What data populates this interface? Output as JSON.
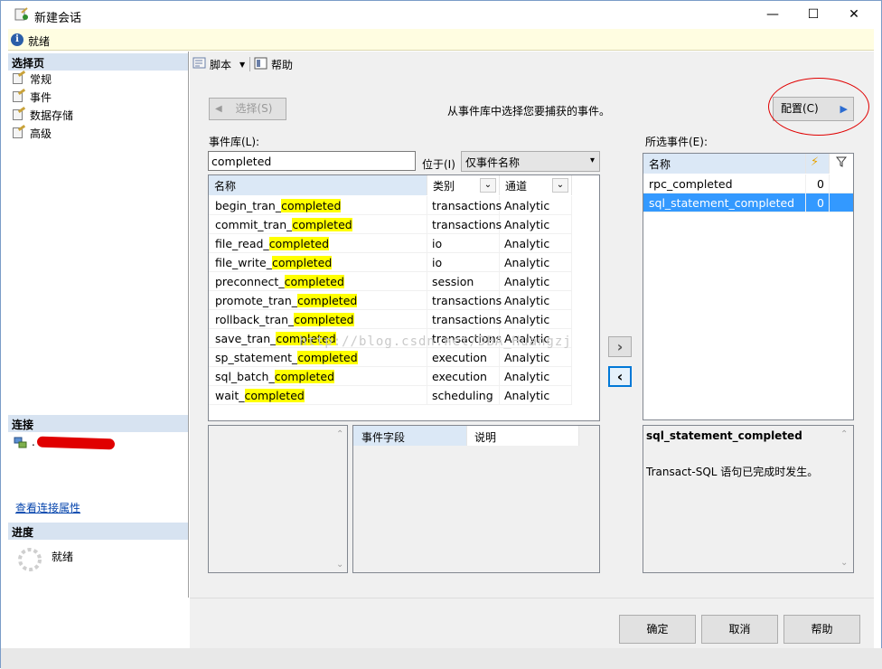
{
  "window": {
    "title": "新建会话",
    "minimize": "—",
    "maximize": "☐",
    "close": "✕"
  },
  "status": {
    "text": "就绪",
    "icon": "info-icon"
  },
  "left": {
    "pages_header": "选择页",
    "pages": [
      {
        "label": "常规",
        "icon": "page-wand-icon"
      },
      {
        "label": "事件",
        "icon": "page-wand-icon"
      },
      {
        "label": "数据存储",
        "icon": "page-wand-icon"
      },
      {
        "label": "高级",
        "icon": "page-wand-icon"
      }
    ],
    "connection_header": "连接",
    "connection_server": ".",
    "view_connection_link": "查看连接属性",
    "progress_header": "进度",
    "progress_status": "就绪"
  },
  "toolbar": {
    "script_label": "脚本",
    "help_label": "帮助"
  },
  "main": {
    "select_button": "选择(S)",
    "instruction": "从事件库中选择您要捕获的事件。",
    "configure_button": "配置(C)",
    "library_label": "事件库(L):",
    "search_value": "completed",
    "position_label": "位于(I)",
    "position_select": "仅事件名称",
    "library_columns": [
      "名称",
      "类别",
      "通道"
    ],
    "library_rows": [
      {
        "prefix": "begin_tran_",
        "match": "completed",
        "category": "transactions",
        "channel": "Analytic"
      },
      {
        "prefix": "commit_tran_",
        "match": "completed",
        "category": "transactions",
        "channel": "Analytic"
      },
      {
        "prefix": "file_read_",
        "match": "completed",
        "category": "io",
        "channel": "Analytic"
      },
      {
        "prefix": "file_write_",
        "match": "completed",
        "category": "io",
        "channel": "Analytic"
      },
      {
        "prefix": "preconnect_",
        "match": "completed",
        "category": "session",
        "channel": "Analytic"
      },
      {
        "prefix": "promote_tran_",
        "match": "completed",
        "category": "transactions",
        "channel": "Analytic"
      },
      {
        "prefix": "rollback_tran_",
        "match": "completed",
        "category": "transactions",
        "channel": "Analytic"
      },
      {
        "prefix": "save_tran_",
        "match": "completed",
        "category": "transactions",
        "channel": "Analytic"
      },
      {
        "prefix": "sp_statement_",
        "match": "completed",
        "category": "execution",
        "channel": "Analytic"
      },
      {
        "prefix": "sql_batch_",
        "match": "completed",
        "category": "execution",
        "channel": "Analytic"
      },
      {
        "prefix": "wait_",
        "match": "completed",
        "category": "scheduling",
        "channel": "Analytic"
      }
    ],
    "watermark": "http://blog.csdn.net/DBA_Huangzj",
    "move_right": "›",
    "move_left": "‹",
    "selected_label": "所选事件(E):",
    "selected_columns": [
      "名称"
    ],
    "selected_rows": [
      {
        "name": "rpc_completed",
        "count": "0",
        "selected": false
      },
      {
        "name": "sql_statement_completed",
        "count": "0",
        "selected": true
      }
    ],
    "field_columns": [
      "事件字段",
      "说明"
    ],
    "detail_title": "sql_statement_completed",
    "detail_text": "Transact-SQL 语句已完成时发生。"
  },
  "buttons": {
    "ok": "确定",
    "cancel": "取消",
    "help": "帮助"
  },
  "colors": {
    "accent": "#3399ff",
    "highlight": "#ffff00",
    "annotation": "#e00000"
  }
}
